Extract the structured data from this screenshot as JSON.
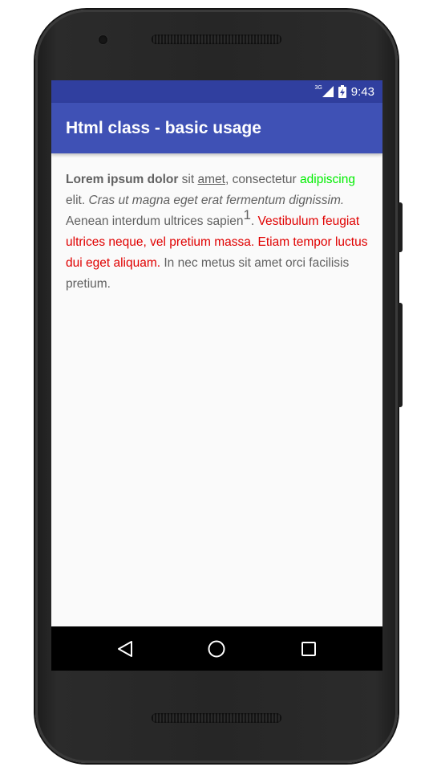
{
  "status_bar": {
    "network_type": "3G",
    "time": "9:43",
    "icons": [
      "signal-icon",
      "battery-charging-icon"
    ]
  },
  "app_bar": {
    "title": "Html class - basic usage"
  },
  "content": {
    "bold_text": "Lorem ipsum dolor",
    "text_sit": " sit ",
    "underlined_text": "amet",
    "text_consectetur": ", consectetur ",
    "green_text": "adipiscing",
    "text_elit": " elit. ",
    "italic_text": "Cras ut magna eget erat fermentum dignissim.",
    "text_aenean": " Aenean interdum ultrices sapien",
    "superscript": "1",
    "period": ". ",
    "red_text": "Vestibulum feugiat ultrices neque, vel pretium massa. Etiam tempor luctus dui eget aliquam.",
    "text_end": " In nec metus sit amet orci facilisis pretium."
  },
  "colors": {
    "status_bar": "#303f9f",
    "app_bar": "#3f51b5",
    "green_text": "#00ee00",
    "red_text": "#e00000",
    "body_text": "#616161"
  },
  "nav_bar": {
    "icons": [
      "back-icon",
      "home-icon",
      "recents-icon"
    ]
  }
}
